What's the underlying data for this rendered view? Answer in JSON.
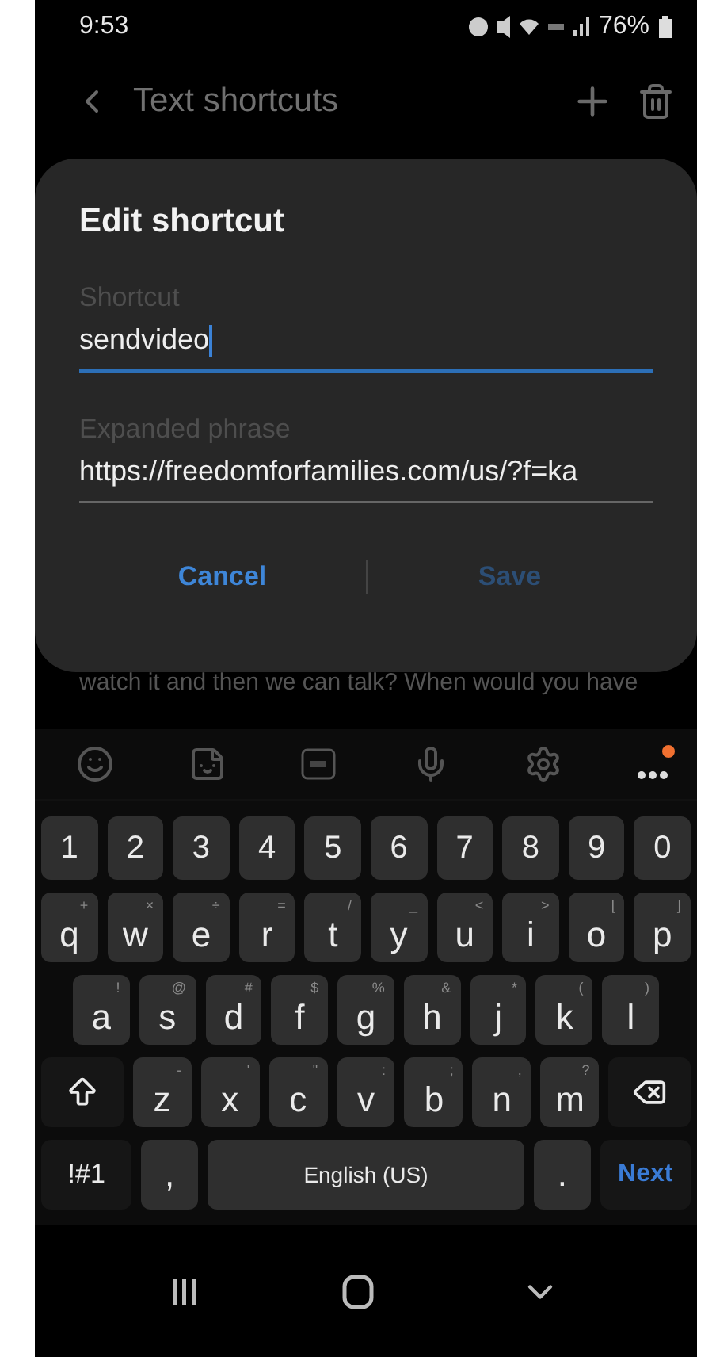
{
  "status_bar": {
    "time": "9:53",
    "battery": "76%"
  },
  "header": {
    "title": "Text shortcuts"
  },
  "background_text": "watch it and then we can talk? When would you have",
  "dialog": {
    "title": "Edit shortcut",
    "fields": [
      {
        "label": "Shortcut",
        "value": "sendvideo",
        "focused": true
      },
      {
        "label": "Expanded phrase",
        "value": "https://freedomforfamilies.com/us/?f=ka",
        "focused": false
      }
    ],
    "buttons": [
      {
        "label": "Cancel",
        "disabled": false
      },
      {
        "label": "Save",
        "disabled": true
      }
    ]
  },
  "keyboard": {
    "toolbar_notification": true,
    "number_row": [
      {
        "kind": "char",
        "label": "1"
      },
      {
        "kind": "char",
        "label": "2"
      },
      {
        "kind": "char",
        "label": "3"
      },
      {
        "kind": "char",
        "label": "4"
      },
      {
        "kind": "char",
        "label": "5"
      },
      {
        "kind": "char",
        "label": "6"
      },
      {
        "kind": "char",
        "label": "7"
      },
      {
        "kind": "char",
        "label": "8"
      },
      {
        "kind": "char",
        "label": "9"
      },
      {
        "kind": "char",
        "label": "0"
      }
    ],
    "top_letter_row": [
      {
        "kind": "char",
        "label": "q",
        "hint": "+"
      },
      {
        "kind": "char",
        "label": "w",
        "hint": "×"
      },
      {
        "kind": "char",
        "label": "e",
        "hint": "÷"
      },
      {
        "kind": "char",
        "label": "r",
        "hint": "="
      },
      {
        "kind": "char",
        "label": "t",
        "hint": "/"
      },
      {
        "kind": "char",
        "label": "y",
        "hint": "_"
      },
      {
        "kind": "char",
        "label": "u",
        "hint": "<"
      },
      {
        "kind": "char",
        "label": "i",
        "hint": ">"
      },
      {
        "kind": "char",
        "label": "o",
        "hint": "["
      },
      {
        "kind": "char",
        "label": "p",
        "hint": "]"
      }
    ],
    "middle_letter_row": [
      {
        "kind": "char",
        "label": "a",
        "hint": "!"
      },
      {
        "kind": "char",
        "label": "s",
        "hint": "@"
      },
      {
        "kind": "char",
        "label": "d",
        "hint": "#"
      },
      {
        "kind": "char",
        "label": "f",
        "hint": "$"
      },
      {
        "kind": "char",
        "label": "g",
        "hint": "%"
      },
      {
        "kind": "char",
        "label": "h",
        "hint": "&"
      },
      {
        "kind": "char",
        "label": "j",
        "hint": "*"
      },
      {
        "kind": "char",
        "label": "k",
        "hint": "("
      },
      {
        "kind": "char",
        "label": "l",
        "hint": ")"
      }
    ],
    "bottom_letter_row": [
      {
        "kind": "shift"
      },
      {
        "kind": "char",
        "label": "z",
        "hint": "-"
      },
      {
        "kind": "char",
        "label": "x",
        "hint": "'"
      },
      {
        "kind": "char",
        "label": "c",
        "hint": "\""
      },
      {
        "kind": "char",
        "label": "v",
        "hint": ":"
      },
      {
        "kind": "char",
        "label": "b",
        "hint": ";"
      },
      {
        "kind": "char",
        "label": "n",
        "hint": ","
      },
      {
        "kind": "char",
        "label": "m",
        "hint": "?"
      },
      {
        "kind": "backspace"
      }
    ],
    "function_row": [
      {
        "kind": "symbols",
        "label": "!#1"
      },
      {
        "kind": "char",
        "label": ","
      },
      {
        "kind": "space",
        "label": "English (US)"
      },
      {
        "kind": "char",
        "label": "."
      },
      {
        "kind": "action",
        "label": "Next"
      }
    ]
  }
}
